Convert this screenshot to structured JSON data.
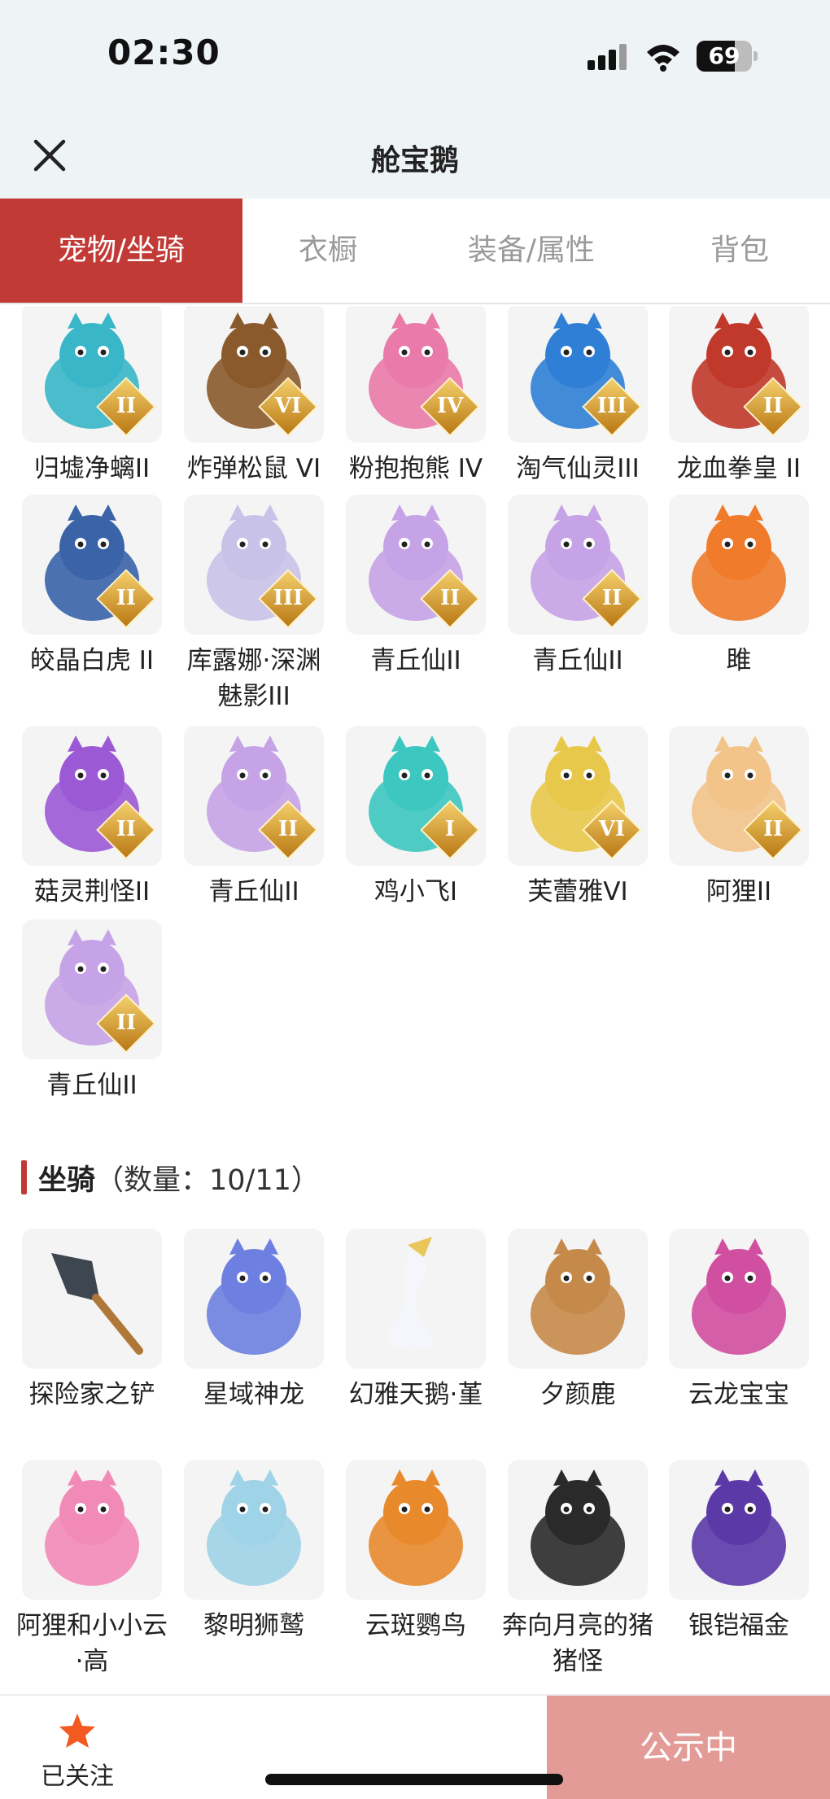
{
  "status_bar": {
    "time": "02:30",
    "battery": "69",
    "battery_level": 0.69
  },
  "header": {
    "title": "舱宝鹅",
    "close_icon": "close-icon"
  },
  "tabs": [
    {
      "label": "宠物/坐骑",
      "active": true
    },
    {
      "label": "衣橱",
      "active": false
    },
    {
      "label": "装备/属性",
      "active": false
    },
    {
      "label": "背包",
      "active": false
    }
  ],
  "pets": [
    {
      "name": "归墟净螭II",
      "badge": "II",
      "art": "dragon-icon",
      "color": "#39b6c8"
    },
    {
      "name": "炸弹松鼠 VI",
      "badge": "VI",
      "art": "squirrel-icon",
      "color": "#8a5a2c"
    },
    {
      "name": "粉抱抱熊 IV",
      "badge": "IV",
      "art": "bear-icon",
      "color": "#e97aa9"
    },
    {
      "name": "淘气仙灵III",
      "badge": "III",
      "art": "spirit-icon",
      "color": "#2f7fd6"
    },
    {
      "name": "龙血拳皇 II",
      "badge": "II",
      "art": "demon-icon",
      "color": "#c0392b"
    },
    {
      "name": "皎晶白虎 II",
      "badge": "II",
      "art": "tiger-icon",
      "color": "#3a63a8"
    },
    {
      "name": "库露娜·深渊魅影III",
      "badge": "III",
      "art": "maiden-icon",
      "color": "#c9c2e8"
    },
    {
      "name": "青丘仙II",
      "badge": "II",
      "art": "fox-maiden-icon",
      "color": "#c6a3e6"
    },
    {
      "name": "青丘仙II",
      "badge": "II",
      "art": "fox-maiden-icon",
      "color": "#c6a3e6"
    },
    {
      "name": "雎",
      "badge": "",
      "art": "phoenix-icon",
      "color": "#ef7b2b"
    },
    {
      "name": "菇灵荆怪II",
      "badge": "II",
      "art": "mushroom-icon",
      "color": "#9b59d6"
    },
    {
      "name": "青丘仙II",
      "badge": "II",
      "art": "fox-maiden-icon",
      "color": "#c6a3e6"
    },
    {
      "name": "鸡小飞I",
      "badge": "I",
      "art": "chick-icon",
      "color": "#3cc7c0"
    },
    {
      "name": "芙蕾雅VI",
      "badge": "VI",
      "art": "goddess-icon",
      "color": "#e8c84a"
    },
    {
      "name": "阿狸II",
      "badge": "II",
      "art": "ali-icon",
      "color": "#f2c48a"
    },
    {
      "name": "青丘仙II",
      "badge": "II",
      "art": "fox-maiden-icon",
      "color": "#c6a3e6"
    }
  ],
  "mount_section": {
    "title": "坐骑",
    "count_label": "（数量：10/11）"
  },
  "mounts": [
    {
      "name": "探险家之铲",
      "art": "shovel-icon",
      "color": "#3e4650"
    },
    {
      "name": "星域神龙",
      "art": "star-dragon-icon",
      "color": "#6d7fe0"
    },
    {
      "name": "幻雅天鹅·堇",
      "art": "swan-icon",
      "color": "#e9c55a"
    },
    {
      "name": "夕颜鹿",
      "art": "deer-icon",
      "color": "#c58a4a"
    },
    {
      "name": "云龙宝宝",
      "art": "baby-dragon-icon",
      "color": "#d04fa0"
    },
    {
      "name": "阿狸和小小云·高",
      "art": "ali-cloud-icon",
      "color": "#f28ab8"
    },
    {
      "name": "黎明狮鹫",
      "art": "griffin-icon",
      "color": "#9fd3e8"
    },
    {
      "name": "云斑鹦鸟",
      "art": "parrot-icon",
      "color": "#e88a2c"
    },
    {
      "name": "奔向月亮的猪猪怪",
      "art": "pig-icon",
      "color": "#2a2a2a"
    },
    {
      "name": "银铠福金",
      "art": "silver-beast-icon",
      "color": "#5b3aa8"
    }
  ],
  "bottom": {
    "follow_label": "已关注",
    "follow_icon": "star-icon",
    "public_label": "公示中"
  },
  "colors": {
    "accent": "#c23a36",
    "public_button": "#e39b98",
    "star": "#f25a22"
  }
}
